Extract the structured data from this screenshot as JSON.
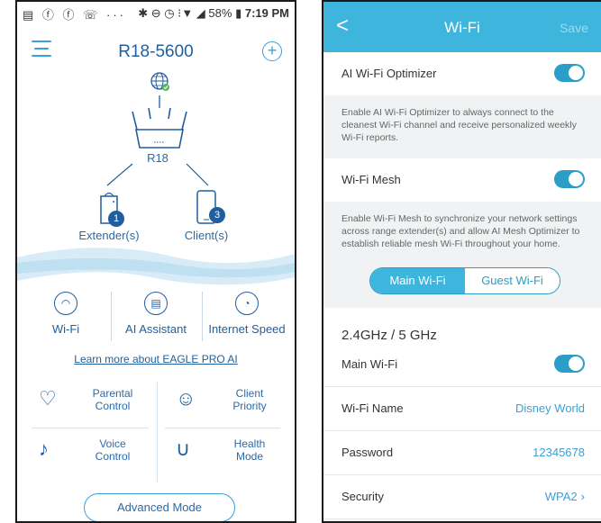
{
  "left": {
    "status": {
      "left_icons": "▤ ⓕ ⓕ ☏ ···",
      "right_icons": "✱ ⊖ ◷ ⁝▼ ◢",
      "battery": "58%",
      "time": "7:19 PM"
    },
    "header": {
      "title": "R18-5600",
      "add_glyph": "+"
    },
    "router_label": "R18",
    "extender": {
      "label": "Extender(s)",
      "count": "1"
    },
    "clients": {
      "label": "Client(s)",
      "count": "3"
    },
    "features": [
      {
        "label": "Wi-Fi",
        "icon": "wifi-icon"
      },
      {
        "label": "AI Assistant",
        "icon": "assistant-icon"
      },
      {
        "label": "Internet Speed",
        "icon": "speedometer-icon"
      }
    ],
    "learn_more": "Learn more about EAGLE PRO AI",
    "grid": [
      {
        "label1": "Parental",
        "label2": "Control",
        "icon": "shield-heart-icon"
      },
      {
        "label1": "Client",
        "label2": "Priority",
        "icon": "client-priority-icon"
      },
      {
        "label1": "Voice",
        "label2": "Control",
        "icon": "voice-mic-icon"
      },
      {
        "label1": "Health",
        "label2": "Mode",
        "icon": "stethoscope-icon"
      }
    ],
    "advanced_button": "Advanced Mode"
  },
  "right": {
    "nav": {
      "back": "<",
      "title": "Wi-Fi",
      "save": "Save"
    },
    "ai_optimizer": {
      "label": "AI Wi-Fi Optimizer",
      "on": true,
      "desc": "Enable AI Wi-Fi Optimizer to always connect to the cleanest Wi-Fi channel and receive personalized weekly Wi-Fi reports."
    },
    "mesh": {
      "label": "Wi-Fi Mesh",
      "on": true,
      "desc": "Enable Wi-Fi Mesh to synchronize your network settings across range extender(s) and allow AI Mesh Optimizer to establish reliable mesh Wi-Fi throughout your home."
    },
    "tabs": {
      "main": "Main Wi-Fi",
      "guest": "Guest Wi-Fi"
    },
    "section_title": "2.4GHz / 5 GHz",
    "main_wifi": {
      "label": "Main Wi-Fi",
      "on": true
    },
    "wifi_name": {
      "label": "Wi-Fi Name",
      "value": "Disney World"
    },
    "password": {
      "label": "Password",
      "value": "12345678"
    },
    "security": {
      "label": "Security",
      "value": "WPA2",
      "chevron": "›"
    }
  }
}
